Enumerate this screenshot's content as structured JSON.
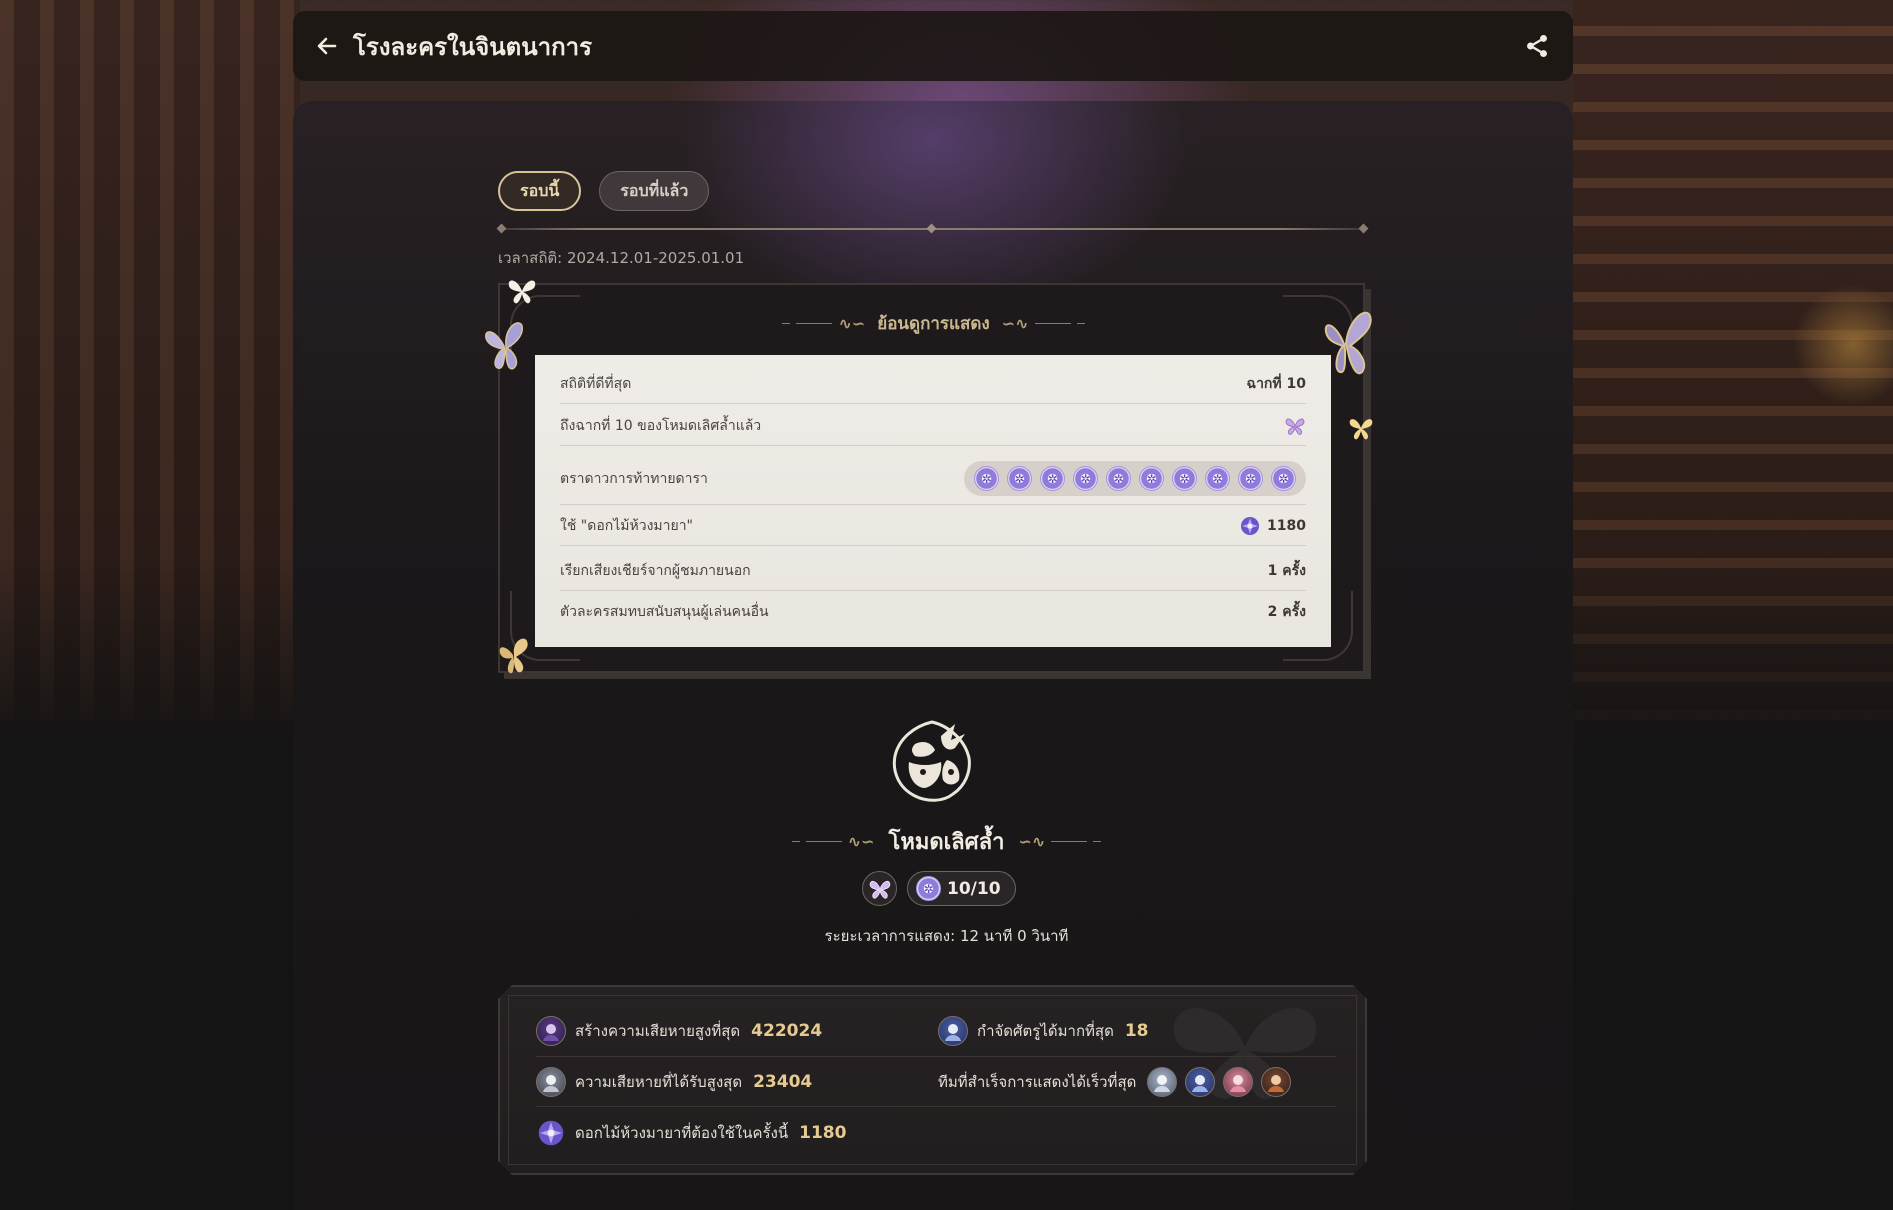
{
  "header": {
    "title": "โรงละครในจินตนาการ",
    "back_icon": "arrow-left-icon",
    "share_icon": "share-icon"
  },
  "tabs": [
    {
      "label": "รอบนี้",
      "active": true
    },
    {
      "label": "รอบที่แล้ว",
      "active": false
    }
  ],
  "stat_time": "เวลาสถิติ: 2024.12.01-2025.01.01",
  "review": {
    "heading": "ย้อนดูการแสดง",
    "rows": [
      {
        "label": "สถิติที่ดีที่สุด",
        "value": "ฉากที่ 10"
      },
      {
        "label": "ถึงฉากที่ 10 ของโหมดเลิศล้ำแล้ว",
        "value_icon": "butterfly-icon"
      },
      {
        "label": "ตราดาวการท้าทายดารา",
        "stars_count": 10
      },
      {
        "label": "ใช้ \"ดอกไม้ห้วงมายา\"",
        "value": "1180",
        "value_icon": "illusion-flower-icon"
      },
      {
        "label": "เรียกเสียงเชียร์จากผู้ชมภายนอก",
        "value": "1 ครั้ง"
      },
      {
        "label": "ตัวละครสมทบสนับสนุนผู้เล่นคนอื่น",
        "value": "2 ครั้ง"
      }
    ]
  },
  "mode": {
    "emblem_icon": "mask-emblem-icon",
    "title": "โหมดเลิศล้ำ",
    "score": "10/10",
    "duration": "ระยะเวลาการแสดง: 12 นาที 0 วินาที"
  },
  "stats": {
    "highest_damage": {
      "label": "สร้างความเสียหายสูงที่สุด",
      "value": "422024"
    },
    "most_defeats": {
      "label": "กำจัดศัตรูได้มากที่สุด",
      "value": "18"
    },
    "highest_taken": {
      "label": "ความเสียหายที่ได้รับสูงสุด",
      "value": "23404"
    },
    "fastest_team": {
      "label": "ทีมที่สำเร็จการแสดงได้เร็วที่สุด"
    },
    "flowers_used": {
      "label": "ดอกไม้ห้วงมายาที่ต้องใช้ในครั้งนี้",
      "value": "1180"
    }
  },
  "colors": {
    "accent_gold": "#e5cb8f",
    "star_purple": "#8f7bd9"
  }
}
